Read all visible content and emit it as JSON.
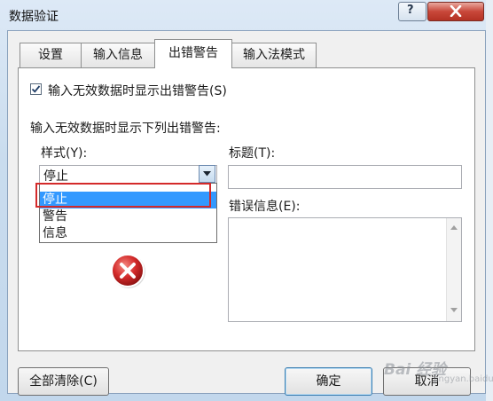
{
  "window": {
    "title": "数据验证",
    "help_label": "?"
  },
  "tabs": [
    {
      "label": "设置",
      "active": false
    },
    {
      "label": "输入信息",
      "active": false
    },
    {
      "label": "出错警告",
      "active": true
    },
    {
      "label": "输入法模式",
      "active": false
    }
  ],
  "error_alert": {
    "show_alert_checkbox_label": "输入无效数据时显示出错警告(S)",
    "show_alert_checked": true,
    "section_label": "输入无效数据时显示下列出错警告:",
    "style_label": "样式(Y):",
    "style_value": "停止",
    "style_options": [
      "停止",
      "警告",
      "信息"
    ],
    "style_selected_index": 0,
    "title_label": "标题(T):",
    "title_value": "",
    "message_label": "错误信息(E):",
    "message_value": "",
    "icon": "stop-error-icon"
  },
  "buttons": {
    "clear_all": "全部清除(C)",
    "ok": "确定",
    "cancel": "取消"
  },
  "watermark": {
    "text": "Bai 经验",
    "sub": "jingyan.baidu.com"
  },
  "colors": {
    "selection": "#3399ff",
    "highlight_box": "#d42a2a",
    "close_button": "#c8473a",
    "stop_icon": "#d32a2a"
  }
}
